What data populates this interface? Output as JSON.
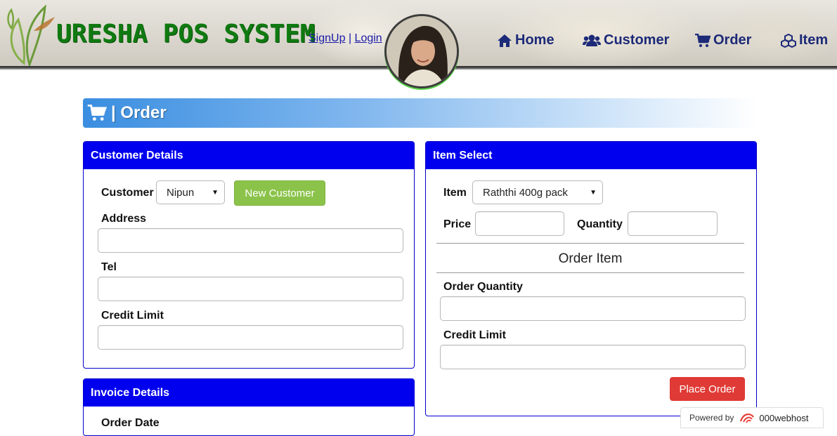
{
  "header": {
    "brand": "URESHA POS SYSTEM",
    "signup_label": "SignUp",
    "separator": "|",
    "login_label": "Login",
    "nav": [
      {
        "label": "Home",
        "icon": "home-icon"
      },
      {
        "label": "Customer",
        "icon": "users-icon"
      },
      {
        "label": "Order",
        "icon": "cart-icon"
      },
      {
        "label": "Item",
        "icon": "cubes-icon"
      }
    ]
  },
  "page": {
    "title": "| Order",
    "title_icon": "cart-icon"
  },
  "customer_details": {
    "heading": "Customer Details",
    "customer_label": "Customer",
    "customer_selected": "Nipun",
    "new_customer_button": "New Customer",
    "address_label": "Address",
    "address_value": "",
    "tel_label": "Tel",
    "tel_value": "",
    "credit_limit_label": "Credit Limit",
    "credit_limit_value": ""
  },
  "invoice_details": {
    "heading": "Invoice Details",
    "order_date_label": "Order Date"
  },
  "item_select": {
    "heading": "Item Select",
    "item_label": "Item",
    "item_selected": "Raththi 400g pack",
    "price_label": "Price",
    "price_value": "",
    "quantity_label": "Quantity",
    "quantity_value": "",
    "order_item_heading": "Order Item",
    "order_quantity_label": "Order Quantity",
    "order_quantity_value": "",
    "credit_limit_label": "Credit Limit",
    "credit_limit_value": "",
    "place_order_button": "Place Order"
  },
  "footer": {
    "powered_by": "Powered by",
    "host": "000webhost"
  },
  "colors": {
    "panel_header": "#0000ee",
    "brand_green": "#0f7a10",
    "nav_text": "#1c2a78",
    "button_green": "#8bc34a",
    "button_red": "#e03a36"
  }
}
